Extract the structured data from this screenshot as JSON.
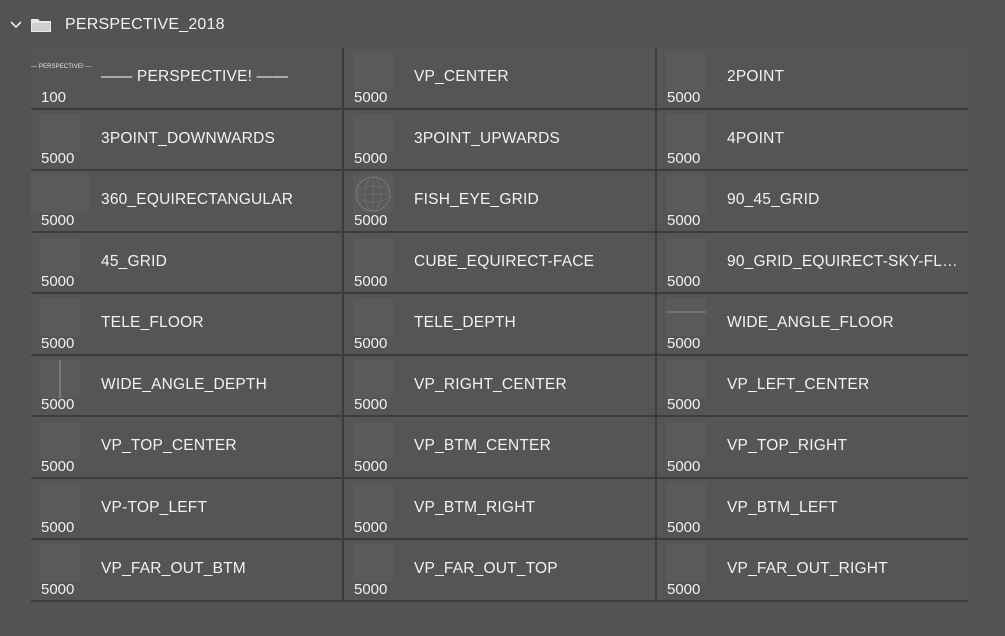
{
  "group": {
    "title": "PERSPECTIVE_2018",
    "expanded_icon": "chevron-down-icon",
    "folder_icon": "folder-icon"
  },
  "colors": {
    "panel_bg": "#535353",
    "tile_bg": "#555555",
    "grid_bg": "#3c3c3c",
    "text": "#f0f0f0"
  },
  "brushes": [
    {
      "size": "100",
      "name": "—— PERSPECTIVE! ——",
      "thumb_text": "— PERSPECTIVE! —",
      "thumb": "text"
    },
    {
      "size": "5000",
      "name": "VP_CENTER",
      "thumb": "plain"
    },
    {
      "size": "5000",
      "name": "2POINT",
      "thumb": "plain"
    },
    {
      "size": "5000",
      "name": "3POINT_DOWNWARDS",
      "thumb": "plain"
    },
    {
      "size": "5000",
      "name": "3POINT_UPWARDS",
      "thumb": "plain"
    },
    {
      "size": "5000",
      "name": "4POINT",
      "thumb": "plain"
    },
    {
      "size": "5000",
      "name": "360_EQUIRECTANGULAR",
      "thumb": "wide"
    },
    {
      "size": "5000",
      "name": "FISH_EYE_GRID",
      "thumb": "globe"
    },
    {
      "size": "5000",
      "name": "90_45_GRID",
      "thumb": "plain"
    },
    {
      "size": "5000",
      "name": "45_GRID",
      "thumb": "plain"
    },
    {
      "size": "5000",
      "name": "CUBE_EQUIRECT-FACE",
      "thumb": "plain"
    },
    {
      "size": "5000",
      "name": "90_GRID_EQUIRECT-SKY-FLO...",
      "thumb": "plain"
    },
    {
      "size": "5000",
      "name": "TELE_FLOOR",
      "thumb": "plain"
    },
    {
      "size": "5000",
      "name": "TELE_DEPTH",
      "thumb": "plain"
    },
    {
      "size": "5000",
      "name": "WIDE_ANGLE_FLOOR",
      "thumb": "hline"
    },
    {
      "size": "5000",
      "name": "WIDE_ANGLE_DEPTH",
      "thumb": "vline"
    },
    {
      "size": "5000",
      "name": "VP_RIGHT_CENTER",
      "thumb": "plain"
    },
    {
      "size": "5000",
      "name": "VP_LEFT_CENTER",
      "thumb": "plain"
    },
    {
      "size": "5000",
      "name": "VP_TOP_CENTER",
      "thumb": "plain"
    },
    {
      "size": "5000",
      "name": "VP_BTM_CENTER",
      "thumb": "plain"
    },
    {
      "size": "5000",
      "name": "VP_TOP_RIGHT",
      "thumb": "plain"
    },
    {
      "size": "5000",
      "name": "VP-TOP_LEFT",
      "thumb": "plain"
    },
    {
      "size": "5000",
      "name": "VP_BTM_RIGHT",
      "thumb": "plain"
    },
    {
      "size": "5000",
      "name": "VP_BTM_LEFT",
      "thumb": "plain"
    },
    {
      "size": "5000",
      "name": "VP_FAR_OUT_BTM",
      "thumb": "plain"
    },
    {
      "size": "5000",
      "name": "VP_FAR_OUT_TOP",
      "thumb": "plain"
    },
    {
      "size": "5000",
      "name": "VP_FAR_OUT_RIGHT",
      "thumb": "plain"
    }
  ]
}
